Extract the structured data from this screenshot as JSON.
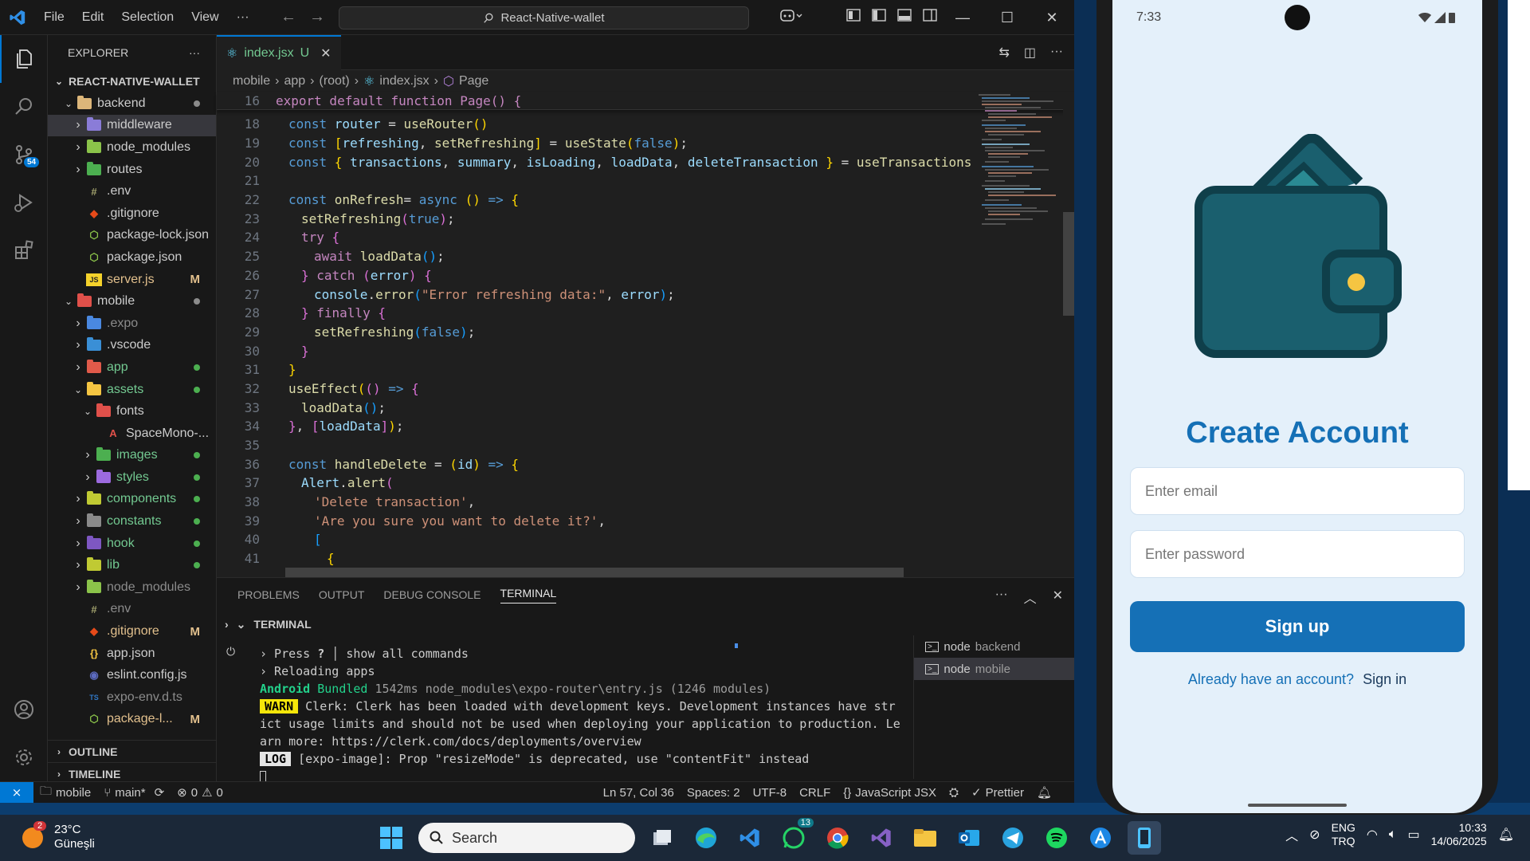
{
  "vscode": {
    "menu": [
      "File",
      "Edit",
      "Selection",
      "View",
      "···"
    ],
    "command_center": "React-Native-wallet",
    "window_controls": [
      "minimize",
      "maximize",
      "close"
    ],
    "activity_badge": "54",
    "explorer": {
      "title": "EXPLORER",
      "more": "···",
      "root": "REACT-NATIVE-WALLET",
      "items": [
        {
          "label": "backend",
          "kind": "folder-open",
          "depth": 1,
          "chev": "v",
          "color": "#dcb67a",
          "status": "dot",
          "status_color": "#8b8b8b",
          "label_color": "#cccccc"
        },
        {
          "label": "middleware",
          "kind": "folder",
          "depth": 2,
          "chev": ">",
          "color": "#8a7cd8",
          "status": "",
          "selected": true,
          "label_color": "#cccccc"
        },
        {
          "label": "node_modules",
          "kind": "folder",
          "depth": 2,
          "chev": ">",
          "color": "#8bc34a",
          "status": "",
          "label_color": "#cccccc"
        },
        {
          "label": "routes",
          "kind": "folder",
          "depth": 2,
          "chev": ">",
          "color": "#4caf50",
          "status": "",
          "label_color": "#cccccc"
        },
        {
          "label": ".env",
          "kind": "env",
          "depth": 2,
          "chev": "",
          "color": "#a0a06c",
          "status": "",
          "label_color": "#cccccc"
        },
        {
          "label": ".gitignore",
          "kind": "git",
          "depth": 2,
          "chev": "",
          "color": "#e64a19",
          "status": "",
          "label_color": "#cccccc"
        },
        {
          "label": "package-lock.json",
          "kind": "npm",
          "depth": 2,
          "chev": "",
          "color": "#8bc34a",
          "status": "",
          "label_color": "#cccccc"
        },
        {
          "label": "package.json",
          "kind": "npm",
          "depth": 2,
          "chev": "",
          "color": "#8bc34a",
          "status": "",
          "label_color": "#cccccc"
        },
        {
          "label": "server.js",
          "kind": "js",
          "depth": 2,
          "chev": "",
          "color": "#f5d22b",
          "status": "M",
          "status_color": "#e2c08d",
          "label_color": "#e2c08d"
        },
        {
          "label": "mobile",
          "kind": "folder-open",
          "depth": 1,
          "chev": "v",
          "color": "#e0504a",
          "status": "dot",
          "status_color": "#8b8b8b",
          "label_color": "#cccccc"
        },
        {
          "label": ".expo",
          "kind": "folder",
          "depth": 2,
          "chev": ">",
          "color": "#4a88e0",
          "status": "",
          "label_color": "#8b8b8b"
        },
        {
          "label": ".vscode",
          "kind": "folder",
          "depth": 2,
          "chev": ">",
          "color": "#3a8fd6",
          "status": "",
          "label_color": "#cccccc"
        },
        {
          "label": "app",
          "kind": "folder",
          "depth": 2,
          "chev": ">",
          "color": "#e05a4a",
          "status": "dot",
          "status_color": "#4caf50",
          "label_color": "#73c991"
        },
        {
          "label": "assets",
          "kind": "folder-open",
          "depth": 2,
          "chev": "v",
          "color": "#f5c542",
          "status": "dot",
          "status_color": "#4caf50",
          "label_color": "#73c991"
        },
        {
          "label": "fonts",
          "kind": "folder-open",
          "depth": 3,
          "chev": "v",
          "color": "#e0504a",
          "status": "",
          "label_color": "#cccccc"
        },
        {
          "label": "SpaceMono-...",
          "kind": "font",
          "depth": 4,
          "chev": "",
          "color": "#e0504a",
          "status": "",
          "label_color": "#cccccc"
        },
        {
          "label": "images",
          "kind": "folder",
          "depth": 3,
          "chev": ">",
          "color": "#4caf50",
          "status": "dot",
          "status_color": "#4caf50",
          "label_color": "#73c991"
        },
        {
          "label": "styles",
          "kind": "folder",
          "depth": 3,
          "chev": ">",
          "color": "#9c6ade",
          "status": "dot",
          "status_color": "#4caf50",
          "label_color": "#73c991"
        },
        {
          "label": "components",
          "kind": "folder",
          "depth": 2,
          "chev": ">",
          "color": "#c0ca33",
          "status": "dot",
          "status_color": "#4caf50",
          "label_color": "#73c991"
        },
        {
          "label": "constants",
          "kind": "folder",
          "depth": 2,
          "chev": ">",
          "color": "#8a8a8a",
          "status": "dot",
          "status_color": "#4caf50",
          "label_color": "#73c991"
        },
        {
          "label": "hook",
          "kind": "folder",
          "depth": 2,
          "chev": ">",
          "color": "#7e57c2",
          "status": "dot",
          "status_color": "#4caf50",
          "label_color": "#73c991"
        },
        {
          "label": "lib",
          "kind": "folder",
          "depth": 2,
          "chev": ">",
          "color": "#c0ca33",
          "status": "dot",
          "status_color": "#4caf50",
          "label_color": "#73c991"
        },
        {
          "label": "node_modules",
          "kind": "folder",
          "depth": 2,
          "chev": ">",
          "color": "#8bc34a",
          "status": "",
          "label_color": "#8b8b8b"
        },
        {
          "label": ".env",
          "kind": "env",
          "depth": 2,
          "chev": "",
          "color": "#a0a06c",
          "status": "",
          "label_color": "#8b8b8b"
        },
        {
          "label": ".gitignore",
          "kind": "git",
          "depth": 2,
          "chev": "",
          "color": "#e64a19",
          "status": "M",
          "status_color": "#e2c08d",
          "label_color": "#e2c08d"
        },
        {
          "label": "app.json",
          "kind": "json",
          "depth": 2,
          "chev": "",
          "color": "#f5c542",
          "status": "",
          "label_color": "#cccccc"
        },
        {
          "label": "eslint.config.js",
          "kind": "eslint",
          "depth": 2,
          "chev": "",
          "color": "#5c6bc0",
          "status": "",
          "label_color": "#cccccc"
        },
        {
          "label": "expo-env.d.ts",
          "kind": "ts",
          "depth": 2,
          "chev": "",
          "color": "#3178c6",
          "status": "",
          "label_color": "#8b8b8b"
        },
        {
          "label": "package-l...",
          "kind": "npm",
          "depth": 2,
          "chev": "",
          "color": "#8bc34a",
          "status": "M",
          "status_color": "#e2c08d",
          "label_color": "#e2c08d"
        }
      ],
      "outline": "OUTLINE",
      "timeline": "TIMELINE"
    },
    "tab": {
      "label": "index.jsx",
      "flag": "U"
    },
    "breadcrumb": [
      "mobile",
      "app",
      "(root)",
      "index.jsx",
      "Page"
    ],
    "sticky_line": {
      "n": "16",
      "text": "export default function Page() {"
    },
    "code_lines": [
      {
        "n": "18",
        "indent": 1,
        "tokens": [
          [
            "k",
            "const "
          ],
          [
            "v",
            "router"
          ],
          [
            "t",
            " = "
          ],
          [
            "fn",
            "useRouter"
          ],
          [
            "b1",
            "()"
          ]
        ]
      },
      {
        "n": "19",
        "indent": 1,
        "tokens": [
          [
            "k",
            "const "
          ],
          [
            "b1",
            "["
          ],
          [
            "v",
            "refreshing"
          ],
          [
            "t",
            ", "
          ],
          [
            "fn",
            "setRefreshing"
          ],
          [
            "b1",
            "]"
          ],
          [
            "t",
            " = "
          ],
          [
            "fn",
            "useState"
          ],
          [
            "b1",
            "("
          ],
          [
            "k",
            "false"
          ],
          [
            "b1",
            ")"
          ],
          [
            "t",
            ";"
          ]
        ]
      },
      {
        "n": "20",
        "indent": 1,
        "tokens": [
          [
            "k",
            "const "
          ],
          [
            "b1",
            "{ "
          ],
          [
            "v",
            "transactions"
          ],
          [
            "t",
            ", "
          ],
          [
            "v",
            "summary"
          ],
          [
            "t",
            ", "
          ],
          [
            "v",
            "isLoading"
          ],
          [
            "t",
            ", "
          ],
          [
            "v",
            "loadData"
          ],
          [
            "t",
            ", "
          ],
          [
            "v",
            "deleteTransaction"
          ],
          [
            "b1",
            " }"
          ],
          [
            "t",
            " = "
          ],
          [
            "fn",
            "useTransactions"
          ]
        ]
      },
      {
        "n": "21",
        "indent": 0,
        "tokens": []
      },
      {
        "n": "22",
        "indent": 1,
        "tokens": [
          [
            "k",
            "const "
          ],
          [
            "fn",
            "onRefresh"
          ],
          [
            "t",
            "= "
          ],
          [
            "k",
            "async "
          ],
          [
            "b1",
            "() "
          ],
          [
            "k",
            "=> "
          ],
          [
            "b1",
            "{"
          ]
        ]
      },
      {
        "n": "23",
        "indent": 2,
        "tokens": [
          [
            "fn",
            "setRefreshing"
          ],
          [
            "b2",
            "("
          ],
          [
            "k",
            "true"
          ],
          [
            "b2",
            ")"
          ],
          [
            "t",
            ";"
          ]
        ]
      },
      {
        "n": "24",
        "indent": 2,
        "tokens": [
          [
            "kc",
            "try "
          ],
          [
            "b2",
            "{"
          ]
        ]
      },
      {
        "n": "25",
        "indent": 3,
        "tokens": [
          [
            "kc",
            "await "
          ],
          [
            "fn",
            "loadData"
          ],
          [
            "b3",
            "()"
          ],
          [
            "t",
            ";"
          ]
        ]
      },
      {
        "n": "26",
        "indent": 2,
        "tokens": [
          [
            "b2",
            "} "
          ],
          [
            "kc",
            "catch "
          ],
          [
            "b2",
            "("
          ],
          [
            "v",
            "error"
          ],
          [
            "b2",
            ") {"
          ]
        ]
      },
      {
        "n": "27",
        "indent": 3,
        "tokens": [
          [
            "v",
            "console"
          ],
          [
            "t",
            "."
          ],
          [
            "fn",
            "error"
          ],
          [
            "b3",
            "("
          ],
          [
            "s",
            "\"Error refreshing data:\""
          ],
          [
            "t",
            ", "
          ],
          [
            "v",
            "error"
          ],
          [
            "b3",
            ")"
          ],
          [
            "t",
            ";"
          ]
        ]
      },
      {
        "n": "28",
        "indent": 2,
        "tokens": [
          [
            "b2",
            "} "
          ],
          [
            "kc",
            "finally "
          ],
          [
            "b2",
            "{"
          ]
        ]
      },
      {
        "n": "29",
        "indent": 3,
        "tokens": [
          [
            "fn",
            "setRefreshing"
          ],
          [
            "b3",
            "("
          ],
          [
            "k",
            "false"
          ],
          [
            "b3",
            ")"
          ],
          [
            "t",
            ";"
          ]
        ]
      },
      {
        "n": "30",
        "indent": 2,
        "tokens": [
          [
            "b2",
            "}"
          ]
        ]
      },
      {
        "n": "31",
        "indent": 1,
        "tokens": [
          [
            "b1",
            "}"
          ]
        ]
      },
      {
        "n": "32",
        "indent": 1,
        "tokens": [
          [
            "fn",
            "useEffect"
          ],
          [
            "b1",
            "("
          ],
          [
            "b2",
            "() "
          ],
          [
            "k",
            "=> "
          ],
          [
            "b2",
            "{"
          ]
        ]
      },
      {
        "n": "33",
        "indent": 2,
        "tokens": [
          [
            "fn",
            "loadData"
          ],
          [
            "b3",
            "()"
          ],
          [
            "t",
            ";"
          ]
        ]
      },
      {
        "n": "34",
        "indent": 1,
        "tokens": [
          [
            "b2",
            "}"
          ],
          [
            "t",
            ", "
          ],
          [
            "b2",
            "["
          ],
          [
            "v",
            "loadData"
          ],
          [
            "b2",
            "]"
          ],
          [
            "b1",
            ")"
          ],
          [
            "t",
            ";"
          ]
        ]
      },
      {
        "n": "35",
        "indent": 0,
        "tokens": []
      },
      {
        "n": "36",
        "indent": 1,
        "tokens": [
          [
            "k",
            "const "
          ],
          [
            "fn",
            "handleDelete"
          ],
          [
            "t",
            " = "
          ],
          [
            "b1",
            "("
          ],
          [
            "v",
            "id"
          ],
          [
            "b1",
            ") "
          ],
          [
            "k",
            "=> "
          ],
          [
            "b1",
            "{"
          ]
        ]
      },
      {
        "n": "37",
        "indent": 2,
        "tokens": [
          [
            "v",
            "Alert"
          ],
          [
            "t",
            "."
          ],
          [
            "fn",
            "alert"
          ],
          [
            "b2",
            "("
          ]
        ]
      },
      {
        "n": "38",
        "indent": 3,
        "tokens": [
          [
            "s",
            "'Delete transaction'"
          ],
          [
            "t",
            ","
          ]
        ]
      },
      {
        "n": "39",
        "indent": 3,
        "tokens": [
          [
            "s",
            "'Are you sure you want to delete it?'"
          ],
          [
            "t",
            ","
          ]
        ]
      },
      {
        "n": "40",
        "indent": 3,
        "tokens": [
          [
            "b3",
            "["
          ]
        ]
      },
      {
        "n": "41",
        "indent": 4,
        "tokens": [
          [
            "b1",
            "{"
          ]
        ]
      }
    ],
    "panel": {
      "tabs": [
        "PROBLEMS",
        "OUTPUT",
        "DEBUG CONSOLE",
        "TERMINAL"
      ],
      "active_tab": "TERMINAL",
      "section": "TERMINAL",
      "lines": [
        {
          "prefix": "› Press ",
          "key": "?",
          "rest": " │ show all commands"
        },
        {
          "prefix": "› Reloading apps",
          "key": "",
          "rest": ""
        }
      ],
      "bundled": {
        "platform": "Android",
        "word": "Bundled",
        "rest": " 1542ms node_modules\\expo-router\\entry.js (1246 modules)"
      },
      "warn": {
        "tag": "WARN",
        "text": " Clerk: Clerk has been loaded with development keys. Development instances have str",
        "l2": "ict usage limits and should not be used when deploying your application to production. Le",
        "l3": "arn more: https://clerk.com/docs/deployments/overview"
      },
      "log": {
        "tag": "LOG",
        "text": " [expo-image]: Prop \"resizeMode\" is deprecated, use \"contentFit\" instead"
      },
      "terminals": [
        {
          "name": "node",
          "label": "backend"
        },
        {
          "name": "node",
          "label": "mobile"
        }
      ]
    },
    "status": {
      "folder": "mobile",
      "branch": "main*",
      "errors": "0",
      "warnings": "0",
      "position": "Ln 57, Col 36",
      "spaces": "Spaces: 2",
      "encoding": "UTF-8",
      "eol": "CRLF",
      "language": "JavaScript JSX",
      "formatter": "Prettier"
    }
  },
  "phone": {
    "time": "7:33",
    "title": "Create Account",
    "email_placeholder": "Enter email",
    "password_placeholder": "Enter password",
    "signup": "Sign up",
    "footer_text": "Already have an account?",
    "footer_link": "Sign in",
    "colors": {
      "accent": "#1570b6",
      "wallet": "#1a5f6e",
      "wallet_dark": "#0f3f4a",
      "coin": "#f5c542"
    }
  },
  "taskbar": {
    "weather_badge": "2",
    "temp": "23°C",
    "weather": "Güneşli",
    "search": "Search",
    "whatsapp_badge": "13",
    "lang1": "ENG",
    "lang2": "TRQ",
    "time": "10:33",
    "date": "14/06/2025"
  }
}
